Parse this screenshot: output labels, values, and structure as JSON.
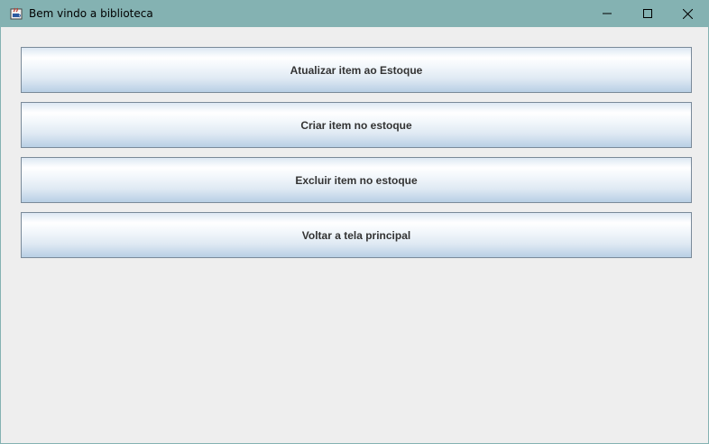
{
  "window": {
    "title": "Bem vindo a biblioteca",
    "icons": {
      "app": "java-cup-icon",
      "minimize": "minimize-icon",
      "maximize": "maximize-icon",
      "close": "close-icon"
    }
  },
  "buttons": [
    {
      "label": "Atualizar item ao Estoque"
    },
    {
      "label": "Criar item no estoque"
    },
    {
      "label": "Excluir item no estoque"
    },
    {
      "label": "Voltar a tela principal"
    }
  ]
}
